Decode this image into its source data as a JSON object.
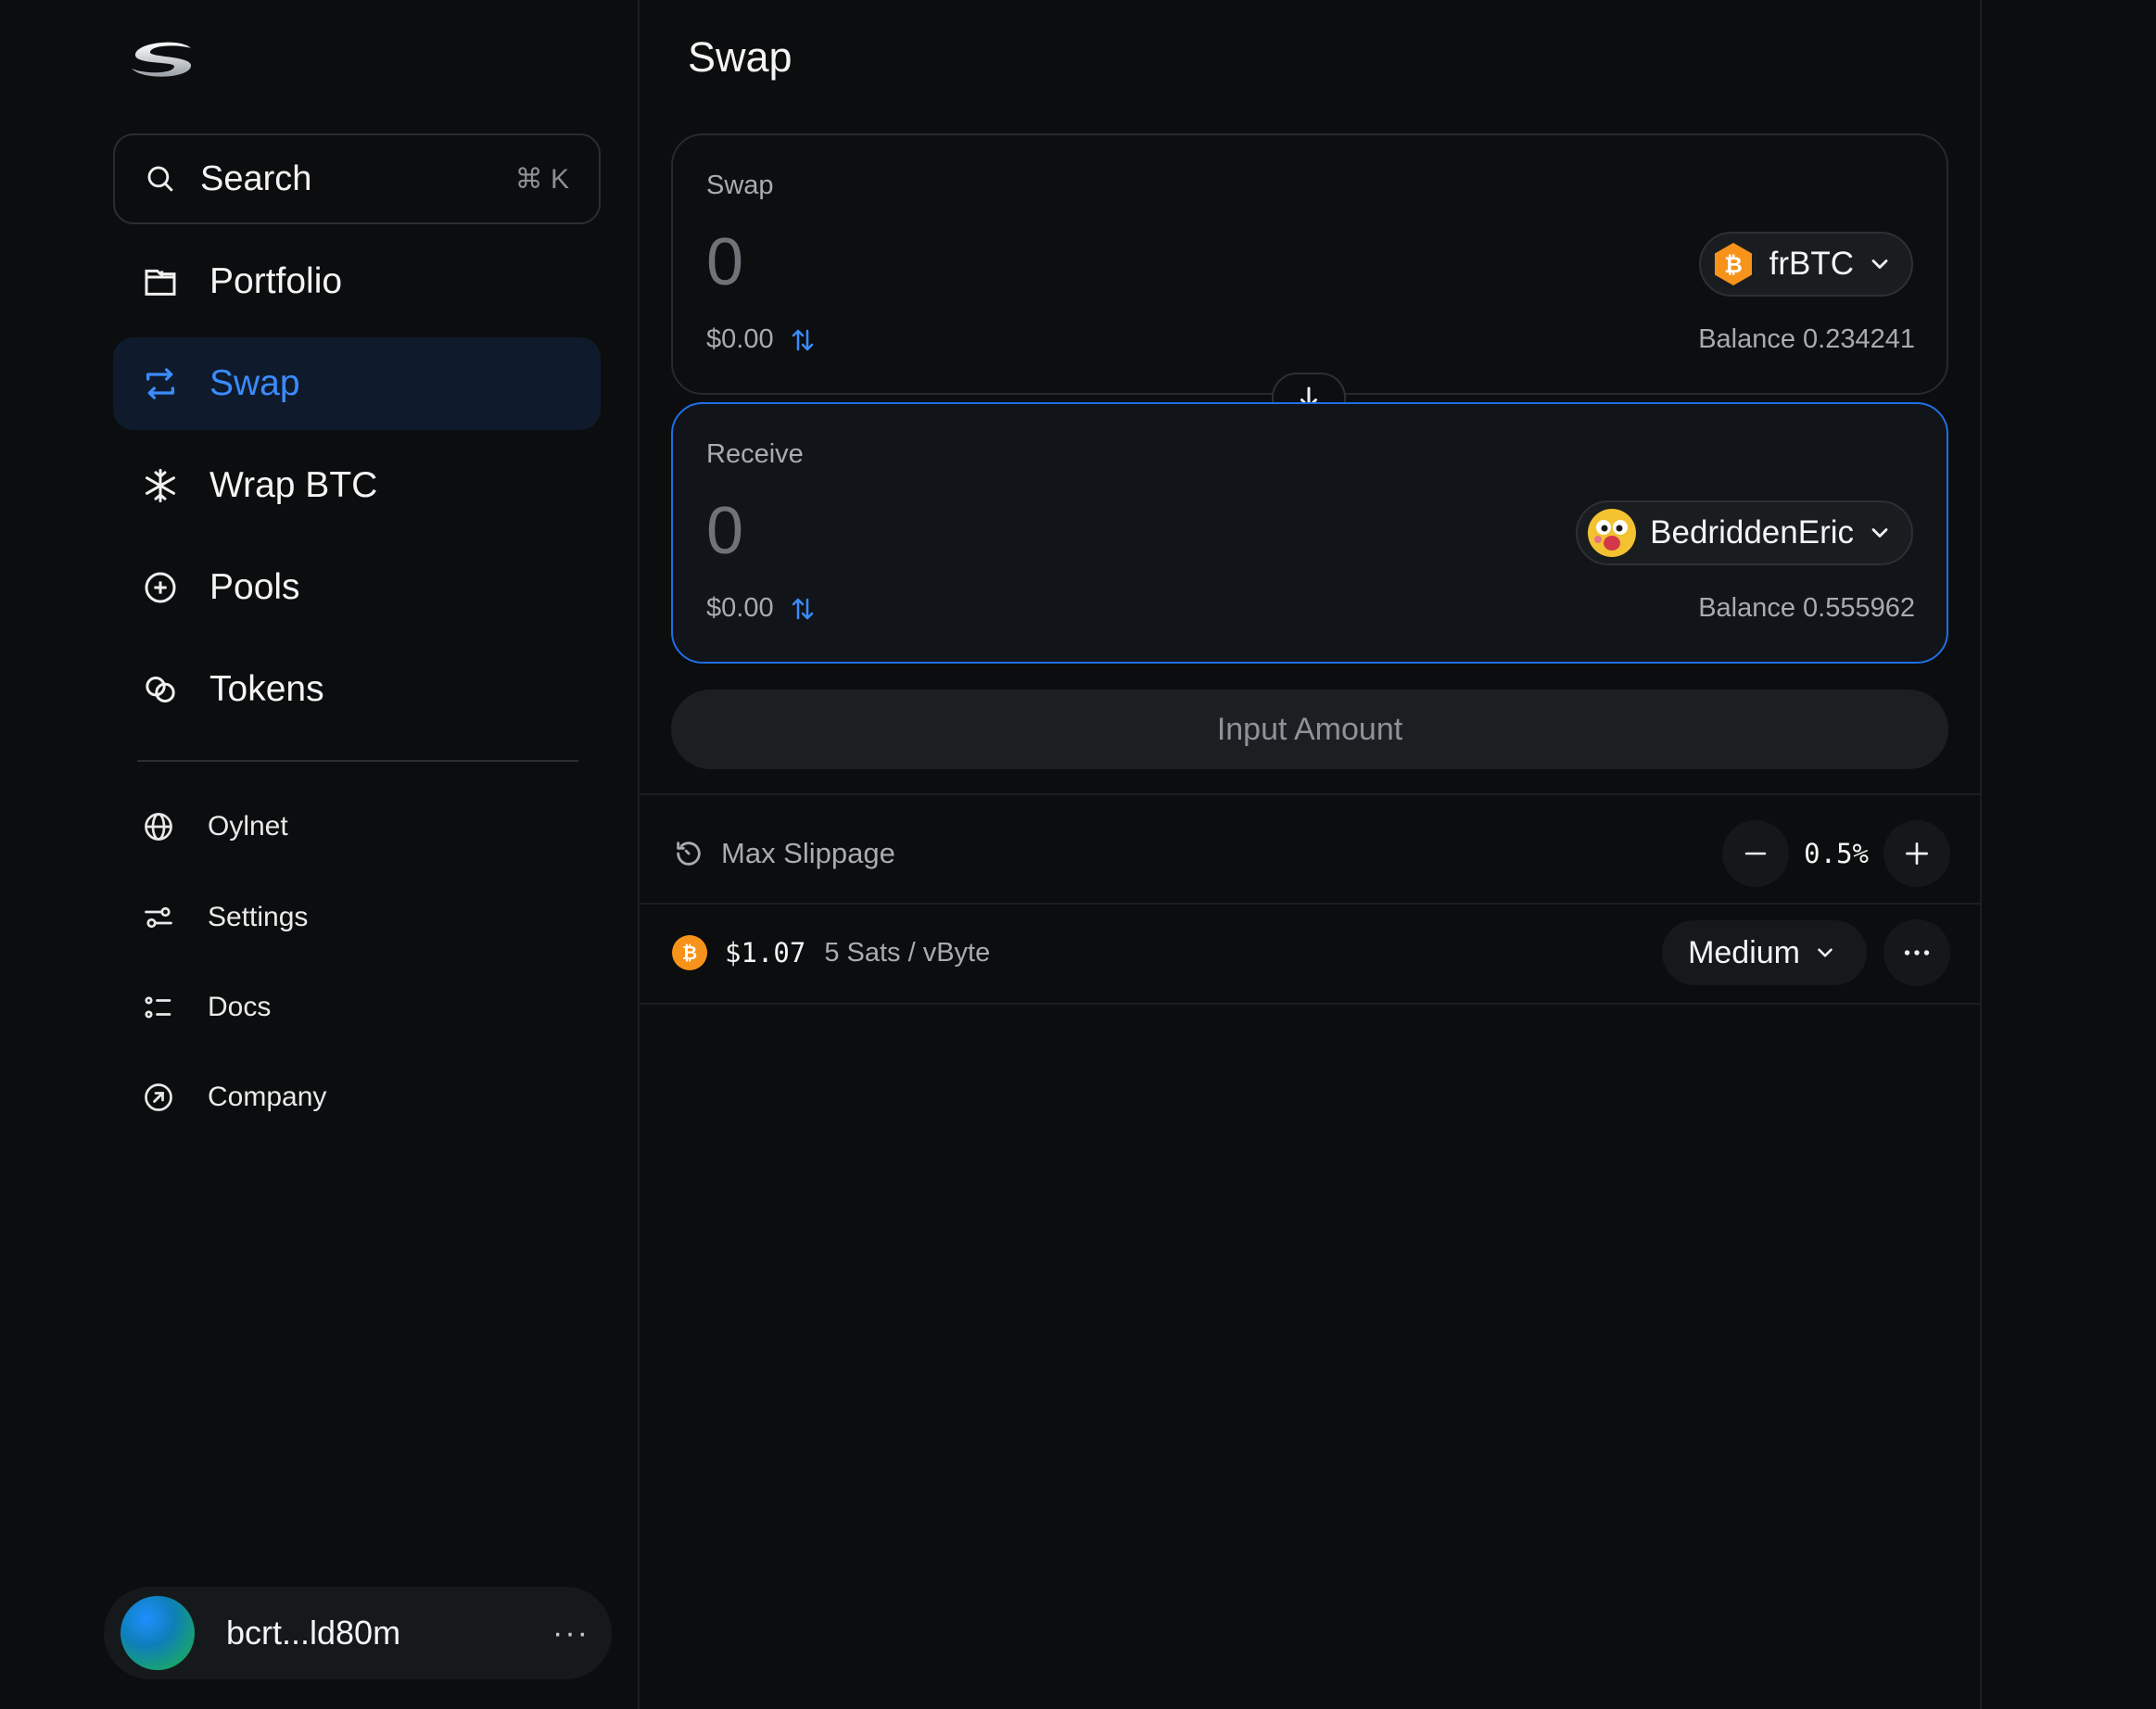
{
  "sidebar": {
    "search": {
      "label": "Search",
      "shortcut": "⌘ K"
    },
    "nav": [
      {
        "label": "Portfolio",
        "icon": "portfolio-icon"
      },
      {
        "label": "Swap",
        "icon": "swap-arrows-icon",
        "active": true
      },
      {
        "label": "Wrap BTC",
        "icon": "snowflake-icon"
      },
      {
        "label": "Pools",
        "icon": "plus-circle-icon"
      },
      {
        "label": "Tokens",
        "icon": "coins-icon"
      }
    ],
    "secondary": [
      {
        "label": "Oylnet",
        "icon": "globe-icon"
      },
      {
        "label": "Settings",
        "icon": "sliders-icon"
      },
      {
        "label": "Docs",
        "icon": "list-icon"
      },
      {
        "label": "Company",
        "icon": "arrow-circle-icon"
      }
    ],
    "account": {
      "address": "bcrt...ld80m",
      "more": "···"
    }
  },
  "main": {
    "title": "Swap",
    "swap_panel": {
      "label": "Swap",
      "amount": "0",
      "usd": "$0.00",
      "token": "frBTC",
      "balance": "Balance 0.234241"
    },
    "receive_panel": {
      "label": "Receive",
      "amount": "0",
      "usd": "$0.00",
      "token": "BedriddenEric",
      "balance": "Balance 0.555962"
    },
    "submit_label": "Input Amount",
    "slippage": {
      "label": "Max Slippage",
      "value": "0.5%"
    },
    "fee": {
      "usd": "$1.07",
      "rate": "5 Sats / vByte",
      "speed": "Medium",
      "more": "···"
    }
  },
  "colors": {
    "background": "#0b0d0e",
    "accent": "#3b8bff",
    "receive_border": "#1f6fe5",
    "bitcoin": "#f7931a"
  }
}
